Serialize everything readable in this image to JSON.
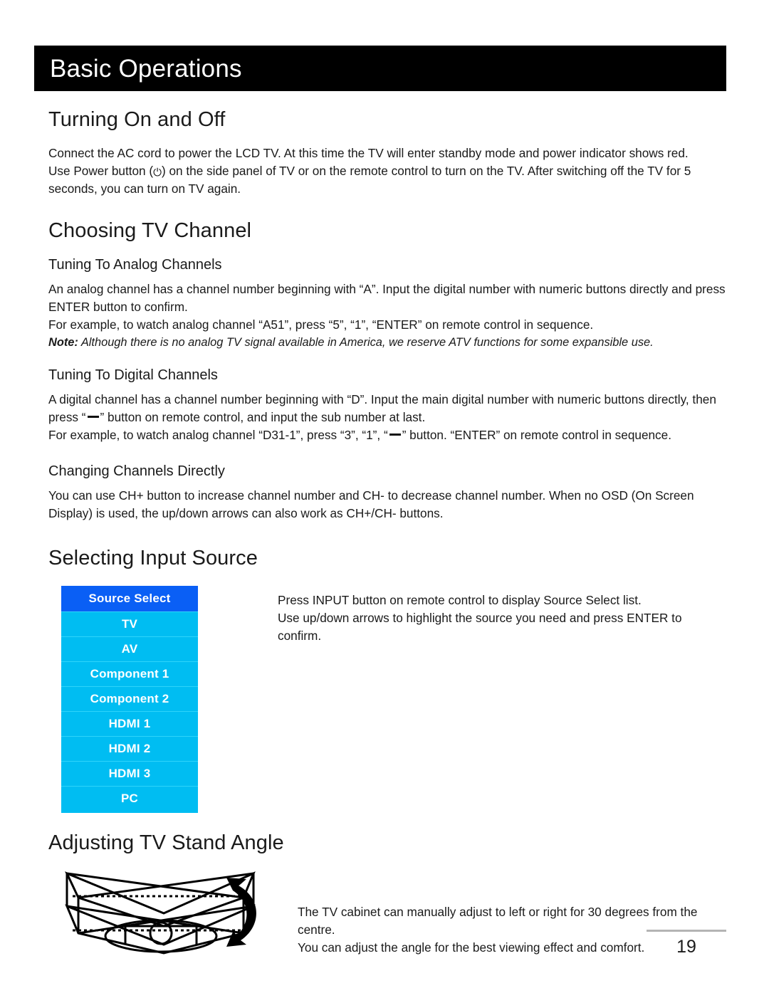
{
  "document": {
    "banner_title": "Basic Operations",
    "page_number": "19"
  },
  "sections": {
    "turning_on_off": {
      "heading": "Turning On and Off",
      "paragraph_1": "Connect the AC cord to power the LCD TV. At this time the TV will enter standby mode and power indicator shows red.",
      "paragraph_2_before_icon": "Use Power button (",
      "power_icon_glyph": "⏻",
      "paragraph_2_after_icon": ") on the side panel of TV or on the remote control to turn on the TV. After switching off the TV for 5 seconds, you can turn on TV again."
    },
    "choosing_tv_channel": {
      "heading": "Choosing TV Channel",
      "analog": {
        "subheading": "Tuning To Analog Channels",
        "paragraph_1": "An analog channel has a channel number beginning with “A”. Input the digital number with numeric buttons directly and press ENTER button to confirm.",
        "paragraph_2": "For example, to watch analog channel “A51”, press “5”, “1”, “ENTER” on remote control in sequence.",
        "note_label": "Note:",
        "note_text": " Although there is no analog TV signal available in America, we reserve ATV functions for some expansible use."
      },
      "digital": {
        "subheading": "Tuning To Digital Channels",
        "paragraph_1_part_a": "A digital channel has a channel number beginning with “D”. Input the main digital number with numeric buttons directly, then press “",
        "paragraph_1_part_b": "” button on remote control, and input the sub number at last.",
        "paragraph_2_part_a": "For example, to watch analog channel “D31-1”, press “3”, “1”, “",
        "paragraph_2_part_b": "” button. “ENTER” on remote control in sequence."
      },
      "changing": {
        "subheading": "Changing Channels Directly",
        "paragraph_1": "You can use CH+ button to increase channel number and CH- to decrease channel number. When no OSD (On Screen Display) is used, the up/down arrows can also work as CH+/CH- buttons."
      }
    },
    "selecting_input_source": {
      "heading": "Selecting Input Source",
      "menu": {
        "title": "Source Select",
        "items": [
          "TV",
          "AV",
          "Component 1",
          "Component 2",
          "HDMI 1",
          "HDMI 2",
          "HDMI 3",
          "PC"
        ]
      },
      "paragraph_1": "Press INPUT button on remote control to display Source Select list.",
      "paragraph_2": "Use up/down arrows to highlight the source you need and press ENTER to confirm."
    },
    "adjusting_stand": {
      "heading": "Adjusting TV Stand Angle",
      "paragraph_1": "The TV cabinet can manually adjust to left or right for 30 degrees from the centre.",
      "paragraph_2": "You can adjust the angle for the best viewing effect and comfort."
    }
  },
  "colors": {
    "banner_background": "#000000",
    "banner_text": "#ffffff",
    "menu_header_blue": "#0a5ff5",
    "menu_item_cyan": "#00bdf2",
    "menu_divider": "#2fd4fb",
    "body_text": "#1a1a1a",
    "footer_rule": "#b4b4b4"
  }
}
